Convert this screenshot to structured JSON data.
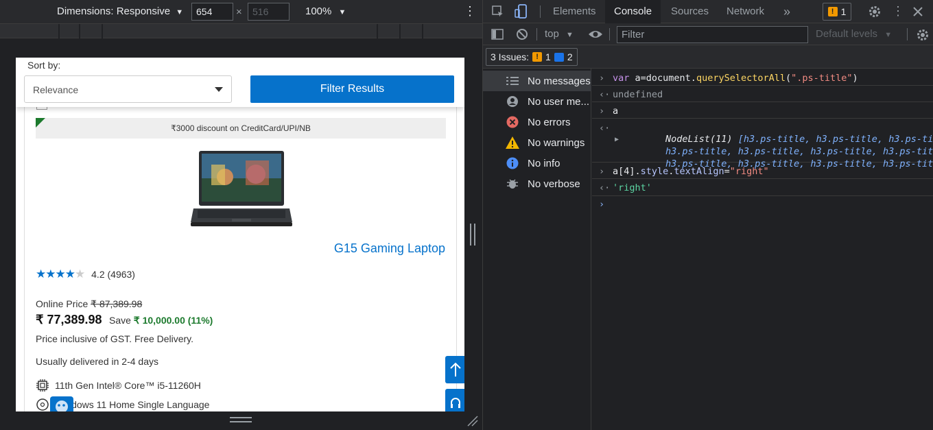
{
  "emulation": {
    "dimensions_label": "Dimensions: Responsive",
    "width_value": "654",
    "height_placeholder": "516",
    "times": "×",
    "zoom_label": "100%"
  },
  "page": {
    "sort_label": "Sort by:",
    "sort_value": "Relevance",
    "filter_button": "Filter Results",
    "promo_text": "₹3000 discount on CreditCard/UPI/NB",
    "product_title": "G15 Gaming Laptop",
    "rating_value": "4.2 (4963)",
    "rating_stars": 4.2,
    "online_price_label": "Online Price",
    "online_price_old": "₹ 87,389.98",
    "price": "₹ 77,389.98",
    "save_label": "Save",
    "save_amount": "₹ 10,000.00 (11%)",
    "gst_text": "Price inclusive of GST. Free Delivery.",
    "delivery_text": "Usually delivered in 2-4 days",
    "spec_cpu": "11th Gen Intel® Core™ i5-11260H",
    "spec_os": "Windows 11 Home Single Language"
  },
  "devtools": {
    "tabs": [
      "Elements",
      "Console",
      "Sources",
      "Network"
    ],
    "more_tabs": "»",
    "issues_count": "1",
    "context": "top",
    "filter_placeholder": "Filter",
    "levels": "Default levels",
    "issues_label": "3 Issues:",
    "issues_warn": "1",
    "issues_info": "2",
    "sidebar": [
      {
        "label": "No messages",
        "icon": "list-icon"
      },
      {
        "label": "No user me...",
        "icon": "user-icon"
      },
      {
        "label": "No errors",
        "icon": "error-icon"
      },
      {
        "label": "No warnings",
        "icon": "warning-icon"
      },
      {
        "label": "No info",
        "icon": "info-icon"
      },
      {
        "label": "No verbose",
        "icon": "bug-icon"
      }
    ],
    "console": {
      "cmd1_kw": "var",
      "cmd1_rest": " a=document.",
      "cmd1_fn": "querySelectorAll",
      "cmd1_arg": "\".ps-title\"",
      "out1": "undefined",
      "cmd2": "a",
      "nodelist_head": "NodeList(11)",
      "nodelist_items": "h3.ps-title",
      "cmd3_a": "a[4].",
      "cmd3_b": "style",
      "cmd3_c": "textAlign",
      "cmd3_val": "\"right\"",
      "out3": "'right'"
    },
    "colors": {
      "accent": "#0672cb",
      "warn": "#f29900",
      "error": "#f28b82"
    }
  }
}
